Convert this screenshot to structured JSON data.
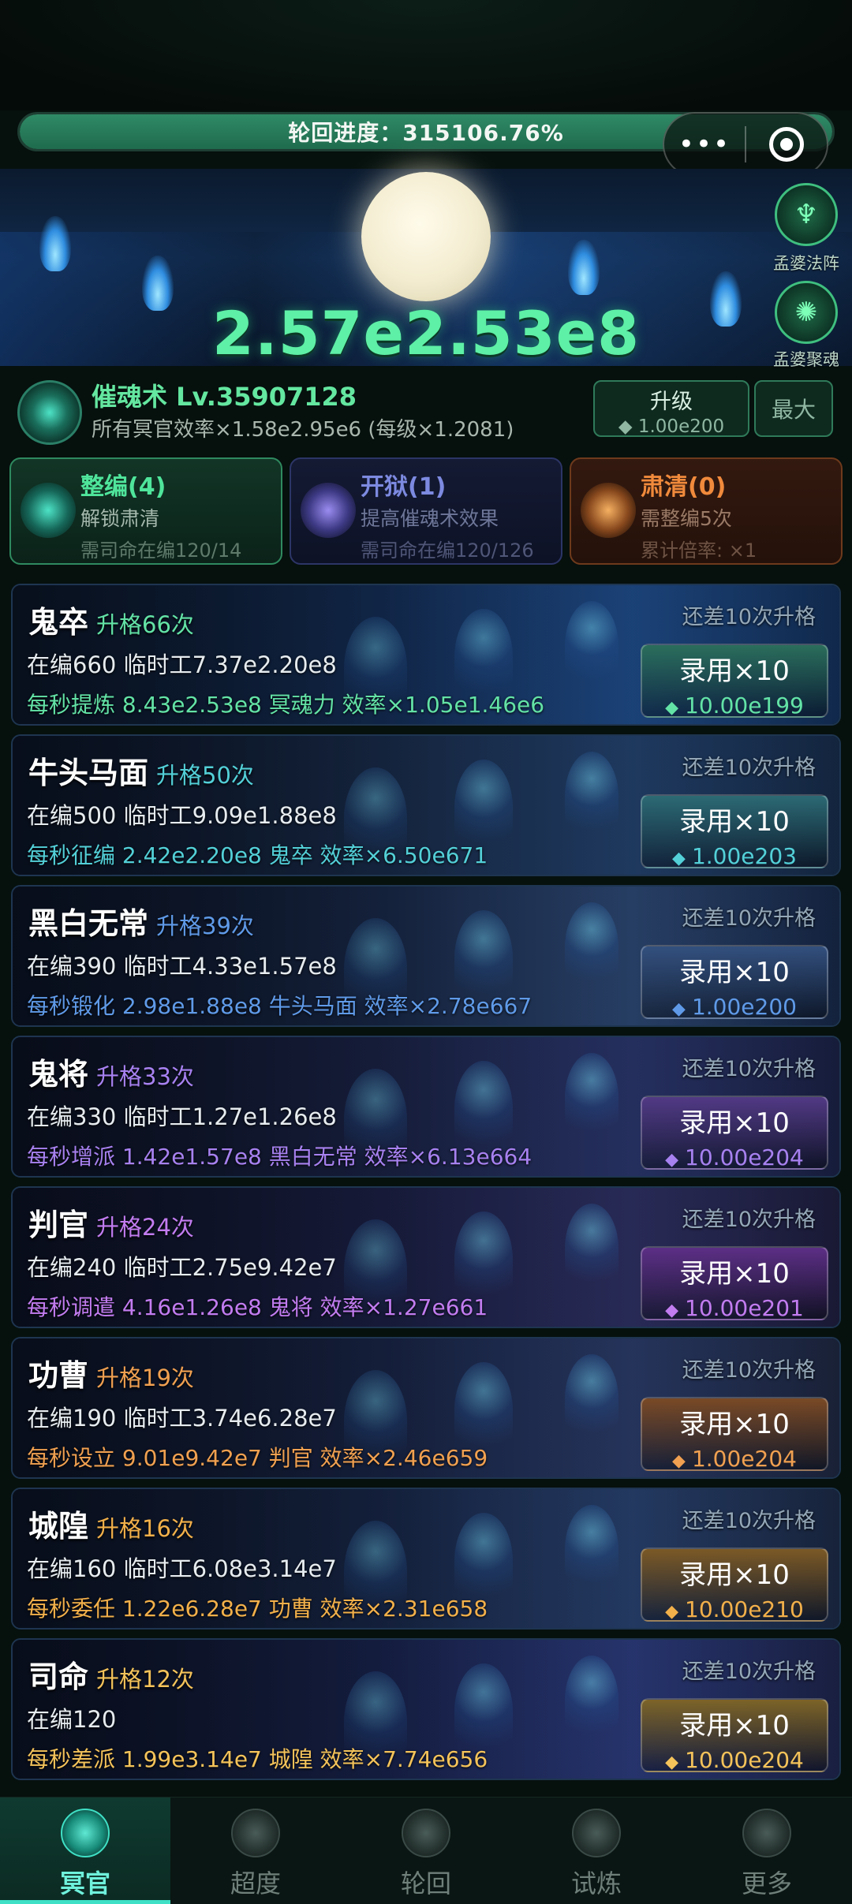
{
  "header": {
    "progress_text": "轮回进度：315106.76%",
    "progress_fraction": 1.0,
    "menu_icon": "more-dots-icon",
    "close_icon": "target-circle-icon"
  },
  "banner": {
    "score": "2.57e2.53e8",
    "side_buttons": [
      {
        "label": "孟婆法阵",
        "icon": "formation-icon"
      },
      {
        "label": "孟婆聚魂",
        "icon": "soul-gather-icon"
      }
    ]
  },
  "skill": {
    "title": "催魂术 Lv.35907128",
    "subtitle": "所有冥官效率×1.58e2.95e6 (每级×1.2081)",
    "upgrade_label": "升级",
    "upgrade_cost": "◆ 1.00e200",
    "max_label": "最大"
  },
  "actions": [
    {
      "title": "整编(4)",
      "desc": "解锁肃清",
      "req": "需司命在编120/14",
      "color": "#4fe59b"
    },
    {
      "title": "开狱(1)",
      "desc": "提高催魂术效果",
      "req": "需司命在编120/126",
      "color": "#7d8ae0"
    },
    {
      "title": "肃清(0)",
      "desc": "需整编5次",
      "req": "累计倍率: ×1",
      "color": "#f08a3c"
    }
  ],
  "units": [
    {
      "name": "鬼卒",
      "rank": "升格66次",
      "count": "在编660   临时工7.37e2.20e8",
      "rate": "每秒提炼 8.43e2.53e8 冥魂力  效率×1.05e1.46e6",
      "remain": "还差10次升格",
      "hire": "录用×10",
      "cost": "10.00e199",
      "accent": "#63e3a6",
      "btn": "#2b6e5c"
    },
    {
      "name": "牛头马面",
      "rank": "升格50次",
      "count": "在编500   临时工9.09e1.88e8",
      "rate": "每秒征编 2.42e2.20e8 鬼卒  效率×6.50e671",
      "remain": "还差10次升格",
      "hire": "录用×10",
      "cost": "1.00e203",
      "accent": "#53d0d8",
      "btn": "#2c6a74"
    },
    {
      "name": "黑白无常",
      "rank": "升格39次",
      "count": "在编390   临时工4.33e1.57e8",
      "rate": "每秒锻化 2.98e1.88e8 牛头马面  效率×2.78e667",
      "remain": "还差10次升格",
      "hire": "录用×10",
      "cost": "1.00e200",
      "accent": "#5f9ae8",
      "btn": "#33507e"
    },
    {
      "name": "鬼将",
      "rank": "升格33次",
      "count": "在编330   临时工1.27e1.26e8",
      "rate": "每秒增派 1.42e1.57e8 黑白无常  效率×6.13e664",
      "remain": "还差10次升格",
      "hire": "录用×10",
      "cost": "10.00e204",
      "accent": "#a781f0",
      "btn": "#523a85"
    },
    {
      "name": "判官",
      "rank": "升格24次",
      "count": "在编240   临时工2.75e9.42e7",
      "rate": "每秒调遣 4.16e1.26e8 鬼将  效率×1.27e661",
      "remain": "还差10次升格",
      "hire": "录用×10",
      "cost": "10.00e201",
      "accent": "#c27cf0",
      "btn": "#5d2f86"
    },
    {
      "name": "功曹",
      "rank": "升格19次",
      "count": "在编190   临时工3.74e6.28e7",
      "rate": "每秒设立 9.01e9.42e7 判官  效率×2.46e659",
      "remain": "还差10次升格",
      "hire": "录用×10",
      "cost": "1.00e204",
      "accent": "#f0a050",
      "btn": "#7a4a26"
    },
    {
      "name": "城隍",
      "rank": "升格16次",
      "count": "在编160   临时工6.08e3.14e7",
      "rate": "每秒委任 1.22e6.28e7 功曹  效率×2.31e658",
      "remain": "还差10次升格",
      "hire": "录用×10",
      "cost": "10.00e210",
      "accent": "#f2b04a",
      "btn": "#7c5a26"
    },
    {
      "name": "司命",
      "rank": "升格12次",
      "count": "在编120",
      "rate": "每秒差派 1.99e3.14e7 城隍  效率×7.74e656",
      "remain": "还差10次升格",
      "hire": "录用×10",
      "cost": "10.00e204",
      "accent": "#f4c35a",
      "btn": "#7d6428"
    }
  ],
  "nav": [
    {
      "label": "冥官",
      "icon": "ghost-official-icon",
      "active": true
    },
    {
      "label": "超度",
      "icon": "lantern-icon",
      "active": false
    },
    {
      "label": "轮回",
      "icon": "spiral-icon",
      "active": false
    },
    {
      "label": "试炼",
      "icon": "flame-trial-icon",
      "active": false
    },
    {
      "label": "更多",
      "icon": "more-icon",
      "active": false
    }
  ]
}
